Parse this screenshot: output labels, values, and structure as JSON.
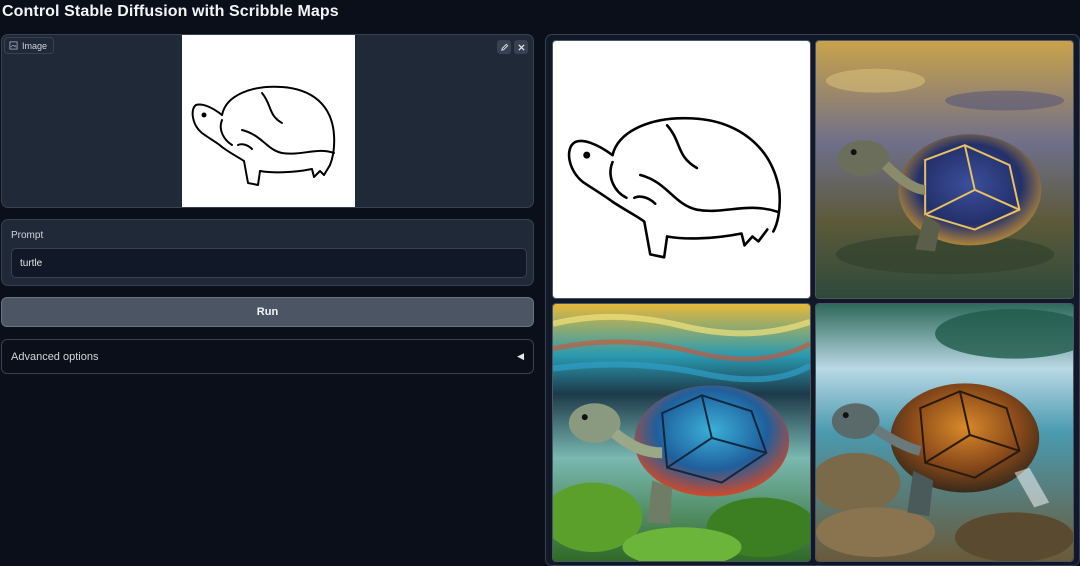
{
  "app": {
    "title": "Control Stable Diffusion with Scribble Maps"
  },
  "image_input": {
    "label": "Image",
    "label_icon": "image-icon",
    "tools": [
      "edit-icon",
      "close-icon"
    ]
  },
  "prompt": {
    "label": "Prompt",
    "value": "turtle"
  },
  "run_button": {
    "label": "Run"
  },
  "advanced": {
    "label": "Advanced options",
    "caret": "◀"
  },
  "gallery": {
    "items": [
      {
        "kind": "scribble map"
      },
      {
        "kind": "generated turtle in water"
      },
      {
        "kind": "generated turtle underwater"
      },
      {
        "kind": "generated turtle on rocks"
      }
    ]
  },
  "colors": {
    "background": "#0b0f19",
    "panel": "#1f2937",
    "border": "#374151",
    "button": "#4b5563"
  }
}
